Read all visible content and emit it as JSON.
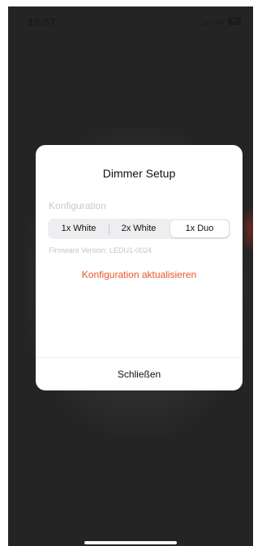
{
  "status_bar": {
    "time": "12:57",
    "network": "5G",
    "battery": "93",
    "signal_bars": 2,
    "signal_bars_total": 4
  },
  "dialog": {
    "title": "Dimmer Setup",
    "section_label": "Konfiguration",
    "options": [
      "1x White",
      "2x White",
      "1x Duo"
    ],
    "selected_option": "1x Duo",
    "firmware": "Firmware Version: LEDU1-0024",
    "update_label": "Konfiguration aktualisieren",
    "close_label": "Schließen"
  },
  "colors": {
    "accent": "#e8552a",
    "backdrop": "#242424",
    "dialog_bg": "#ffffff",
    "muted_text": "#c9c9cc"
  }
}
